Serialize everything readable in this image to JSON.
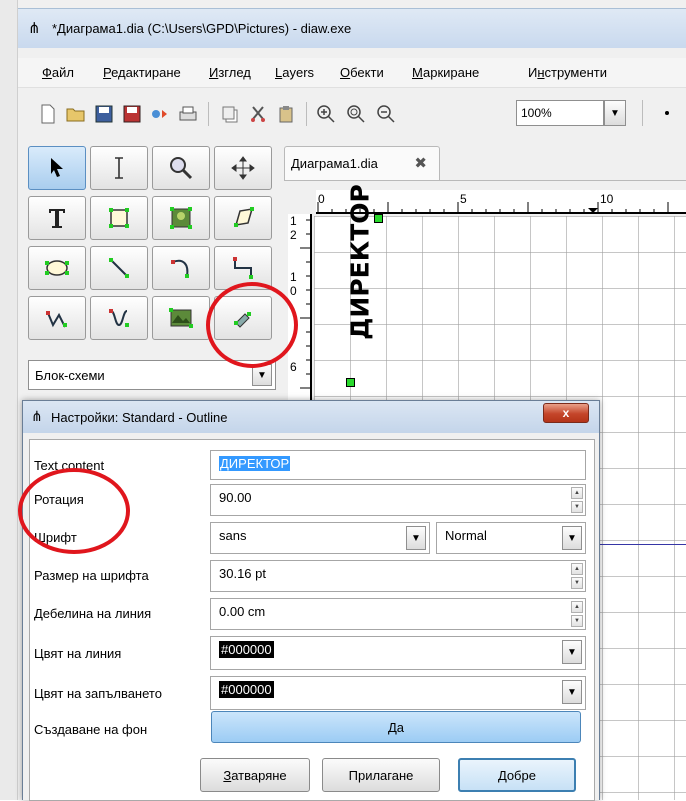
{
  "window": {
    "title": "*Диаграма1.dia (C:\\Users\\GPD\\Pictures) - diaw.exe"
  },
  "menu": [
    {
      "label": "Файл",
      "key": "Ф",
      "rest": "айл"
    },
    {
      "label": "Редактиране",
      "key": "Р",
      "rest": "едактиране"
    },
    {
      "label": "Изглед",
      "key": "И",
      "rest": "зглед"
    },
    {
      "label": "Layers",
      "key": "L",
      "rest": "ayers"
    },
    {
      "label": "Обекти",
      "key": "О",
      "rest": "бекти"
    },
    {
      "label": "Маркиране",
      "key": "М",
      "rest": "аркиране"
    },
    {
      "label": "Инструменти",
      "key": "н",
      "pre": "И",
      "rest": "струменти"
    }
  ],
  "toolbar": {
    "zoom_value": "100%"
  },
  "sheet_selector": {
    "value": "Блок-схеми"
  },
  "tab": {
    "label": "Диаграма1.dia"
  },
  "ruler": {
    "h_labels": [
      "0",
      "5",
      "10"
    ],
    "v_labels": [
      "1",
      "2",
      "1",
      "0",
      "6"
    ]
  },
  "canvas": {
    "text_object": "ДИРЕКТОР"
  },
  "dialog": {
    "title": "Настройки: Standard - Outline",
    "close_label": "x",
    "rows": {
      "text_content": {
        "label": "Text content",
        "value": "ДИРЕКТОР"
      },
      "rotation": {
        "label": "Ротация",
        "value": "90.00"
      },
      "font": {
        "label": "Шрифт",
        "family": "sans",
        "style": "Normal"
      },
      "font_size": {
        "label": "Размер на шрифта",
        "value": "30.16 pt"
      },
      "line_width": {
        "label": "Дебелина на линия",
        "value": "0.00 cm"
      },
      "line_color": {
        "label": "Цвят на линия",
        "value": "#000000"
      },
      "fill_color": {
        "label": "Цвят на запълването",
        "value": "#000000"
      },
      "background": {
        "label": "Създаване на фон",
        "value": "Да"
      }
    },
    "buttons": {
      "close": {
        "key": "З",
        "rest": "атваряне"
      },
      "apply": {
        "label": "Прилагане"
      },
      "ok": {
        "key": "Д",
        "rest": "обре"
      }
    }
  },
  "colors": {
    "annotation": "#e0161d",
    "handle": "#29d92c",
    "selection": "#3399ff"
  }
}
